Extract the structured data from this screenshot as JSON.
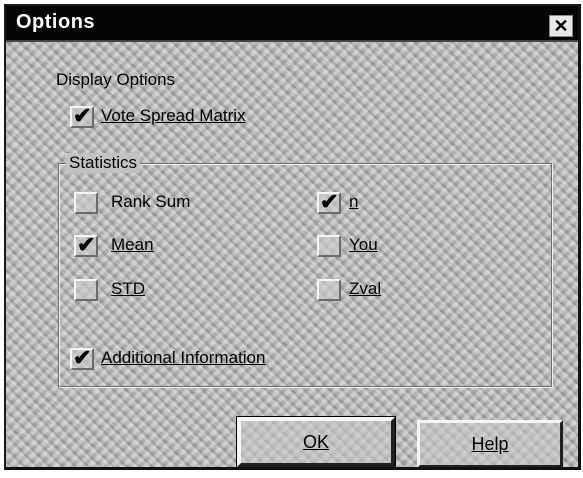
{
  "dialog": {
    "title": "Options",
    "close_glyph": "✕"
  },
  "display_options": {
    "label": "Display Options",
    "vote_spread_matrix": {
      "label": "Vote Spread Matrix",
      "checked": true
    }
  },
  "statistics": {
    "label": "Statistics",
    "items": [
      {
        "id": "rank-sum",
        "label": "Rank Sum",
        "checked": false
      },
      {
        "id": "mean",
        "label": "Mean",
        "checked": true
      },
      {
        "id": "std",
        "label": "STD",
        "checked": false
      },
      {
        "id": "n",
        "label": "n",
        "checked": true
      },
      {
        "id": "you",
        "label": "You",
        "checked": false
      },
      {
        "id": "zval",
        "label": "Zval",
        "checked": false
      }
    ]
  },
  "additional_information": {
    "label": "Additional Information",
    "checked": true
  },
  "buttons": {
    "ok": "OK",
    "help": "Help"
  },
  "check_glyph": "✔",
  "icons": {
    "close": "close-icon",
    "check": "checkmark-icon"
  }
}
